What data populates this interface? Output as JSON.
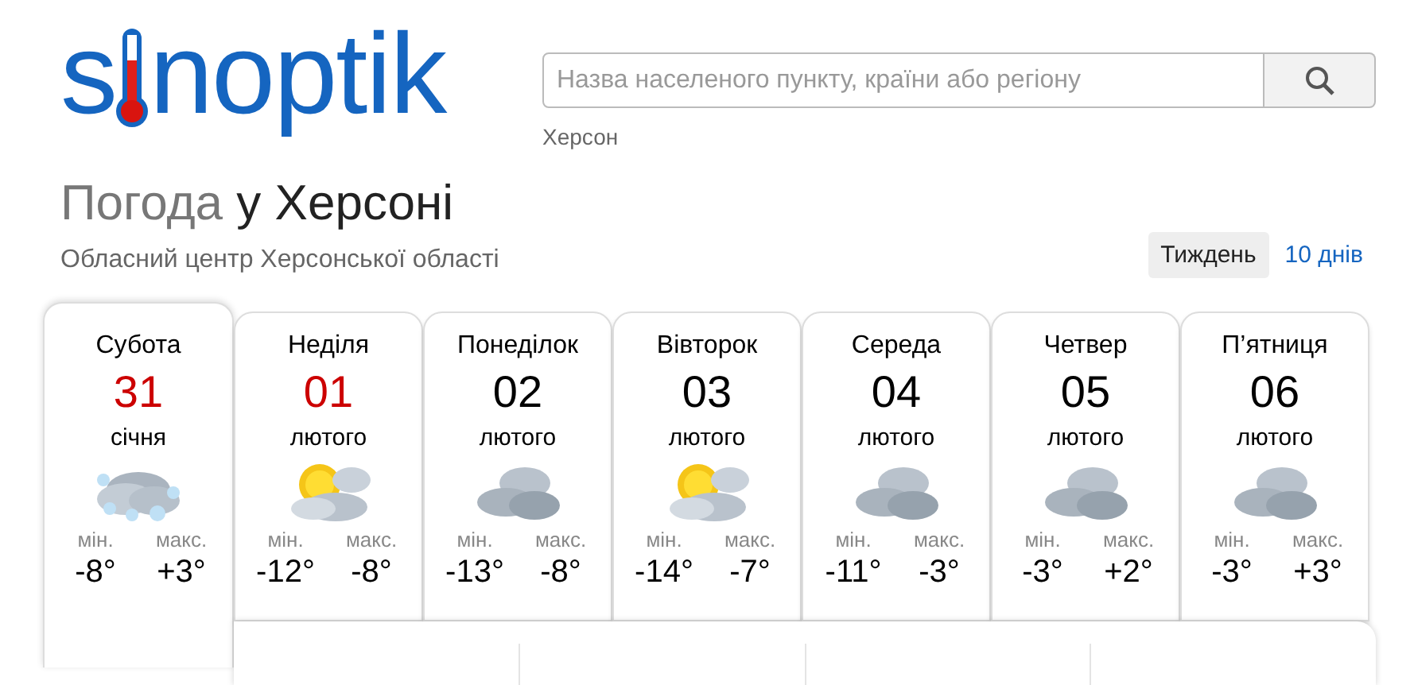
{
  "logo": {
    "left": "s",
    "right": "noptik"
  },
  "search": {
    "placeholder": "Назва населеного пункту, країни або регіону",
    "recent": "Херсон"
  },
  "heading": {
    "prefix": "Погода",
    "place": "у Херсоні",
    "subtitle": "Обласний центр Херсонської області"
  },
  "tabs": [
    {
      "label": "Тиждень",
      "selected": true
    },
    {
      "label": "10 днів",
      "selected": false
    }
  ],
  "days": [
    {
      "name": "Субота",
      "date": "31",
      "month": "січня",
      "weekend": true,
      "selected": true,
      "kind": "snow",
      "min_label": "мін.",
      "min": "-8°",
      "max_label": "макс.",
      "max": "+3°"
    },
    {
      "name": "Неділя",
      "date": "01",
      "month": "лютого",
      "weekend": true,
      "selected": false,
      "kind": "sunny",
      "min_label": "мін.",
      "min": "-12°",
      "max_label": "макс.",
      "max": "-8°"
    },
    {
      "name": "Понеділок",
      "date": "02",
      "month": "лютого",
      "weekend": false,
      "selected": false,
      "kind": "cloudy",
      "min_label": "мін.",
      "min": "-13°",
      "max_label": "макс.",
      "max": "-8°"
    },
    {
      "name": "Вівторок",
      "date": "03",
      "month": "лютого",
      "weekend": false,
      "selected": false,
      "kind": "sunny",
      "min_label": "мін.",
      "min": "-14°",
      "max_label": "макс.",
      "max": "-7°"
    },
    {
      "name": "Середа",
      "date": "04",
      "month": "лютого",
      "weekend": false,
      "selected": false,
      "kind": "cloudy",
      "min_label": "мін.",
      "min": "-11°",
      "max_label": "макс.",
      "max": "-3°"
    },
    {
      "name": "Четвер",
      "date": "05",
      "month": "лютого",
      "weekend": false,
      "selected": false,
      "kind": "cloudy",
      "min_label": "мін.",
      "min": "-3°",
      "max_label": "макс.",
      "max": "+2°"
    },
    {
      "name": "П’ятниця",
      "date": "06",
      "month": "лютого",
      "weekend": false,
      "selected": false,
      "kind": "cloudy",
      "min_label": "мін.",
      "min": "-3°",
      "max_label": "макс.",
      "max": "+3°"
    }
  ]
}
